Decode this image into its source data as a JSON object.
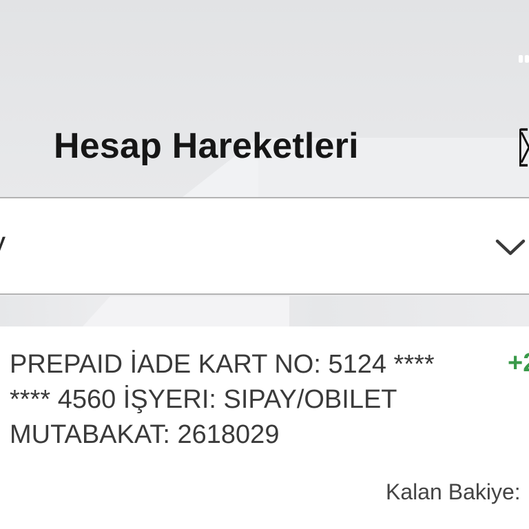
{
  "header": {
    "title": "Hesap Hareketleri",
    "icon": "receipt-icon"
  },
  "account_selector": {
    "value": "y",
    "icon": "chevron-down-icon"
  },
  "transaction": {
    "description_lines": [
      "PREPAID İADE KART NO: 5124 ****",
      "**** 4560 İŞYERI: SIPAY/OBILET",
      "MUTABAKAT: 2618029"
    ],
    "amount": "+2",
    "balance_label": "Kalan Bakiye:"
  },
  "colors": {
    "amount_positive": "#3a9a4a",
    "header_bg": "#e2e3e5",
    "title_text": "#161616"
  }
}
